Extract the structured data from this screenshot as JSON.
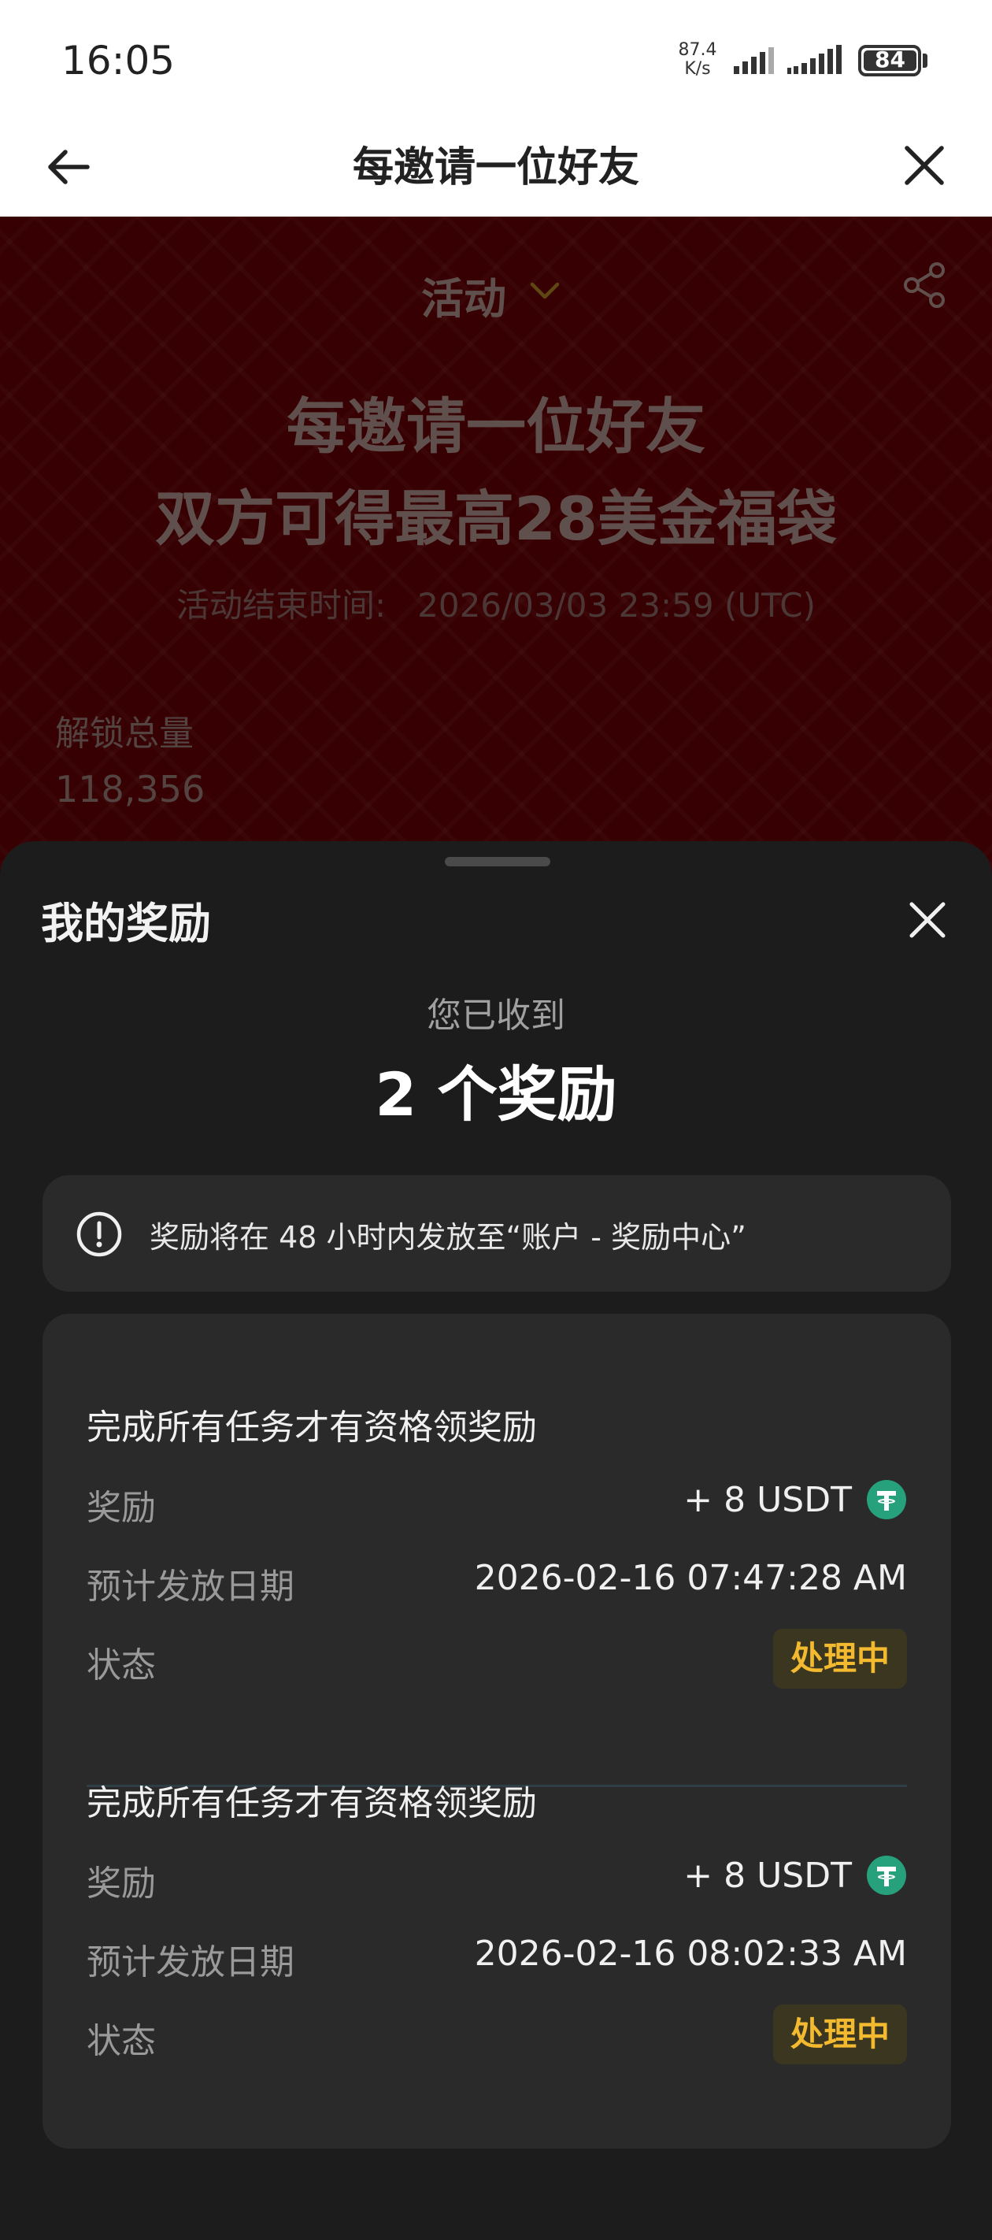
{
  "status_bar": {
    "time": "16:05",
    "net_speed_value": "87.4",
    "net_speed_unit": "K/s",
    "battery": "84"
  },
  "header": {
    "title": "每邀请一位好友"
  },
  "banner": {
    "activity_label": "活动",
    "title_line1": "每邀请一位好友",
    "title_line2": "双方可得最高28美金福袋",
    "end_time_label": "活动结束时间:",
    "end_time_value": "2026/03/03 23:59 (UTC)",
    "unlock_label": "解锁总量",
    "unlock_value": "118,356"
  },
  "sheet": {
    "title": "我的奖励",
    "received_label": "您已收到",
    "received_count": "2 个奖励",
    "notice": "奖励将在 48 小时内发放至“账户 - 奖励中心”",
    "rewards": [
      {
        "title": "完成所有任务才有资格领奖励",
        "reward_label": "奖励",
        "reward_value": "+ 8 USDT",
        "date_label": "预计发放日期",
        "date_value": "2026-02-16 07:47:28 AM",
        "status_label": "状态",
        "status_value": "处理中"
      },
      {
        "title": "完成所有任务才有资格领奖励",
        "reward_label": "奖励",
        "reward_value": "+ 8 USDT",
        "date_label": "预计发放日期",
        "date_value": "2026-02-16 08:02:33 AM",
        "status_label": "状态",
        "status_value": "处理中"
      }
    ]
  },
  "colors": {
    "accent_status": "#f3ba2f",
    "usdt": "#26a17b",
    "banner_red": "#520004",
    "sheet_bg": "#1c1c1c"
  },
  "icons": [
    "back-arrow-icon",
    "close-icon",
    "chevron-down-icon",
    "share-icon",
    "info-icon",
    "usdt-icon",
    "signal-icon",
    "battery-icon"
  ]
}
